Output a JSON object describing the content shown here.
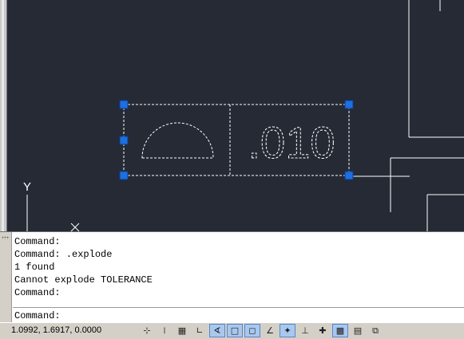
{
  "drawing": {
    "tolerance_symbol": "semicircle-profile-symbol",
    "tolerance_value": ".010",
    "ucs_y_label": "Y",
    "ucs_x_label": "X"
  },
  "command_line": {
    "history": [
      "Command:",
      "Command: .explode",
      "1 found",
      "Cannot explode TOLERANCE",
      "Command:"
    ],
    "prompt": "Command:"
  },
  "status_bar": {
    "coordinates": "1.0992, 1.6917, 0.0000",
    "toggles": [
      {
        "name": "infer-constraints-icon",
        "glyph": "⊹",
        "on": false
      },
      {
        "name": "snap-mode-icon",
        "glyph": "⁞",
        "on": false
      },
      {
        "name": "grid-display-icon",
        "glyph": "▦",
        "on": false
      },
      {
        "name": "ortho-mode-icon",
        "glyph": "∟",
        "on": false
      },
      {
        "name": "polar-tracking-icon",
        "glyph": "∢",
        "on": true
      },
      {
        "name": "object-snap-icon",
        "glyph": "□",
        "on": true
      },
      {
        "name": "3d-object-snap-icon",
        "glyph": "◻",
        "on": true
      },
      {
        "name": "object-snap-tracking-icon",
        "glyph": "∠",
        "on": false
      },
      {
        "name": "dynamic-ucs-icon",
        "glyph": "✦",
        "on": true
      },
      {
        "name": "dynamic-input-icon",
        "glyph": "⊥",
        "on": false
      },
      {
        "name": "lineweight-icon",
        "glyph": "✚",
        "on": false
      },
      {
        "name": "transparency-icon",
        "glyph": "▩",
        "on": true
      },
      {
        "name": "quick-properties-icon",
        "glyph": "▤",
        "on": false
      },
      {
        "name": "selection-cycling-icon",
        "glyph": "⧉",
        "on": false
      }
    ]
  },
  "colors": {
    "canvas_background": "#252a34",
    "drawing_lines": "#ffffff",
    "grip_color": "#1f6fe0"
  }
}
